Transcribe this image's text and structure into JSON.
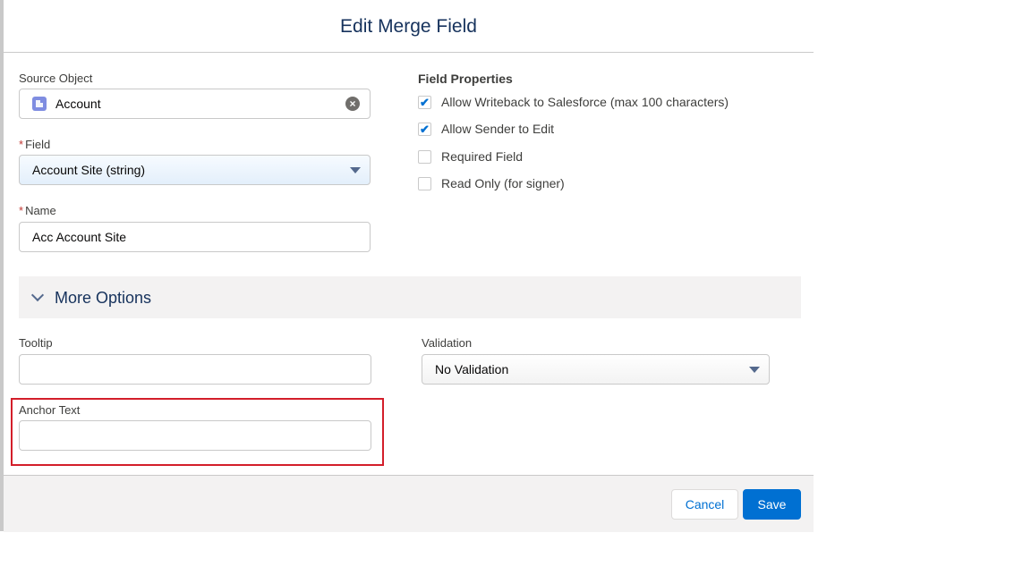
{
  "modal": {
    "title": "Edit Merge Field"
  },
  "source_object": {
    "label": "Source Object",
    "value": "Account",
    "icon": "account-object-icon",
    "clear_icon": "clear-icon"
  },
  "field": {
    "required_mark": "*",
    "label": "Field",
    "value": "Account Site (string)"
  },
  "name": {
    "required_mark": "*",
    "label": "Name",
    "value": "Acc Account Site"
  },
  "field_properties": {
    "title": "Field Properties",
    "items": [
      {
        "label": "Allow Writeback to Salesforce (max 100 characters)",
        "checked": true,
        "mark": "✔"
      },
      {
        "label": "Allow Sender to Edit",
        "checked": true,
        "mark": "✔"
      },
      {
        "label": "Required Field",
        "checked": false,
        "mark": ""
      },
      {
        "label": "Read Only (for signer)",
        "checked": false,
        "mark": ""
      }
    ]
  },
  "more_options": {
    "label": "More Options",
    "expanded": true
  },
  "tooltip": {
    "label": "Tooltip",
    "value": ""
  },
  "validation": {
    "label": "Validation",
    "value": "No Validation"
  },
  "anchor_text": {
    "label": "Anchor Text",
    "value": ""
  },
  "footer": {
    "cancel_label": "Cancel",
    "save_label": "Save"
  },
  "colors": {
    "brand_blue": "#0070d2",
    "title_navy": "#16325c",
    "required_red": "#c23934",
    "highlight_red": "#d31e2a"
  }
}
